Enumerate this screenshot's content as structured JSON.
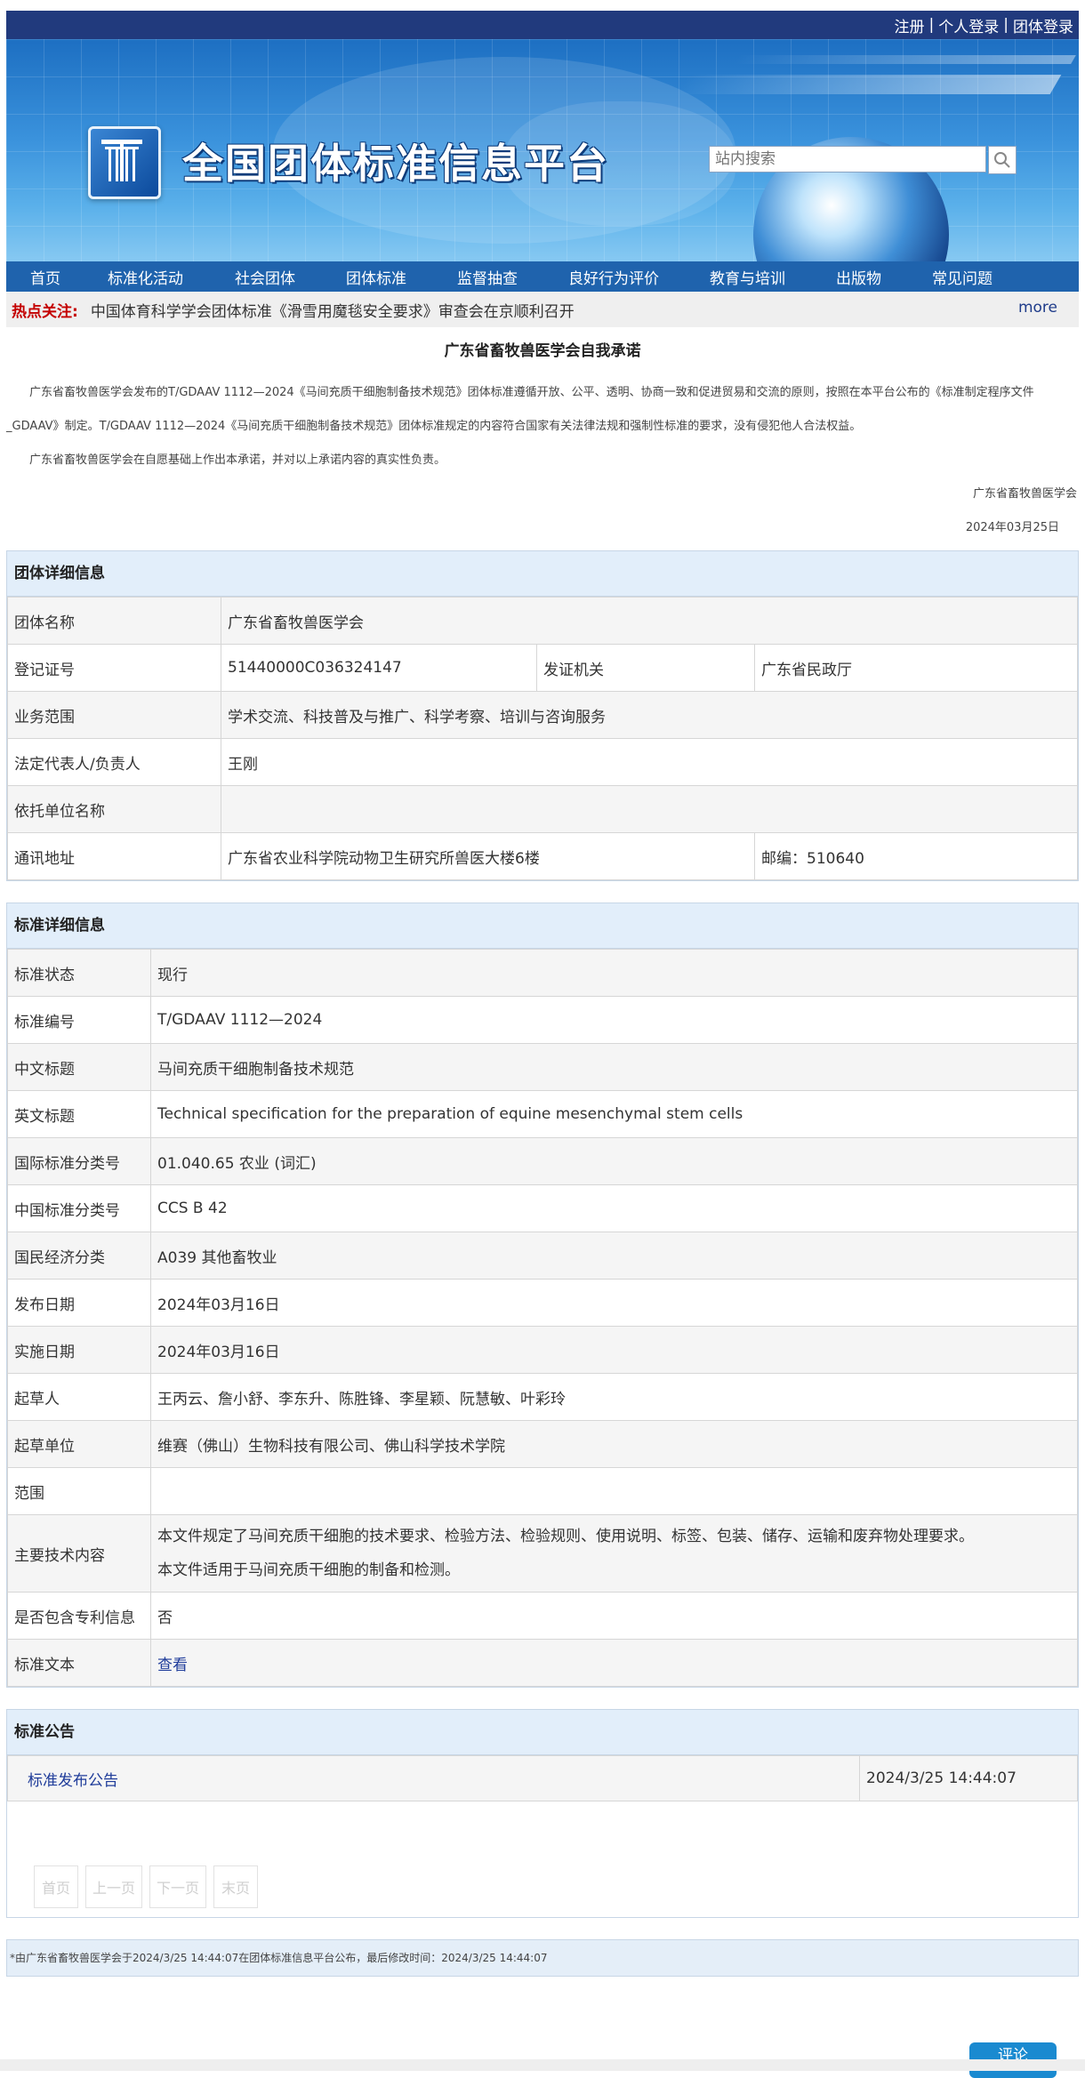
{
  "topbar": {
    "register": "注册",
    "personal_login": "个人登录",
    "group_login": "团体登录",
    "separator": "|"
  },
  "banner": {
    "site_title": "全国团体标准信息平台",
    "search_placeholder": "站内搜索"
  },
  "nav": {
    "items": [
      "首页",
      "标准化活动",
      "社会团体",
      "团体标准",
      "监督抽查",
      "良好行为评价",
      "教育与培训",
      "出版物",
      "常见问题"
    ]
  },
  "hot": {
    "label": "热点关注:",
    "news": "中国体育科学学会团体标准《滑雪用魔毯安全要求》审查会在京顺利召开",
    "more": "more"
  },
  "promise": {
    "title": "广东省畜牧兽医学会自我承诺",
    "p1": "广东省畜牧兽医学会发布的T/GDAAV 1112—2024《马间充质干细胞制备技术规范》团体标准遵循开放、公平、透明、协商一致和促进贸易和交流的原则，按照在本平台公布的《标准制定程序文件_GDAAV》制定。T/GDAAV 1112—2024《马间充质干细胞制备技术规范》团体标准规定的内容符合国家有关法律法规和强制性标准的要求，没有侵犯他人合法权益。",
    "p2": "广东省畜牧兽医学会在自愿基础上作出本承诺，并对以上承诺内容的真实性负责。",
    "sign": "广东省畜牧兽医学会",
    "date": "2024年03月25日"
  },
  "group": {
    "header": "团体详细信息",
    "name_label": "团体名称",
    "name": "广东省畜牧兽医学会",
    "reg_label": "登记证号",
    "reg": "51440000C036324147",
    "issuer_label": "发证机关",
    "issuer": "广东省民政厅",
    "scope_label": "业务范围",
    "scope": "学术交流、科技普及与推广、科学考察、培训与咨询服务",
    "rep_label": "法定代表人/负责人",
    "rep": "王刚",
    "unit_label": "依托单位名称",
    "unit": "",
    "addr_label": "通讯地址",
    "addr": "广东省农业科学院动物卫生研究所兽医大楼6楼",
    "zip": "邮编：510640"
  },
  "standard": {
    "header": "标准详细信息",
    "rows": [
      {
        "k": "标准状态",
        "v": "现行"
      },
      {
        "k": "标准编号",
        "v": "T/GDAAV 1112—2024"
      },
      {
        "k": "中文标题",
        "v": "马间充质干细胞制备技术规范"
      },
      {
        "k": "英文标题",
        "v": "Technical specification for the preparation of equine mesenchymal stem cells"
      },
      {
        "k": "国际标准分类号",
        "v": "01.040.65 农业 (词汇)"
      },
      {
        "k": "中国标准分类号",
        "v": "CCS B 42"
      },
      {
        "k": "国民经济分类",
        "v": "A039 其他畜牧业"
      },
      {
        "k": "发布日期",
        "v": "2024年03月16日"
      },
      {
        "k": "实施日期",
        "v": "2024年03月16日"
      },
      {
        "k": "起草人",
        "v": "王丙云、詹小舒、李东升、陈胜锋、李星颖、阮慧敏、叶彩玲"
      },
      {
        "k": "起草单位",
        "v": "维赛（佛山）生物科技有限公司、佛山科学技术学院"
      },
      {
        "k": "范围",
        "v": ""
      }
    ],
    "tech_label": "主要技术内容",
    "tech1": "本文件规定了马间充质干细胞的技术要求、检验方法、检验规则、使用说明、标签、包装、储存、运输和废弃物处理要求。",
    "tech2": "本文件适用于马间充质干细胞的制备和检测。",
    "patent_label": "是否包含专利信息",
    "patent": "否",
    "text_label": "标准文本",
    "text_link": "查看"
  },
  "notice": {
    "header": "标准公告",
    "item": "标准发布公告",
    "time": "2024/3/25 14:44:07",
    "pager": [
      "首页",
      "上一页",
      "下一页",
      "末页"
    ]
  },
  "footer": {
    "note": "*由广东省畜牧兽医学会于2024/3/25 14:44:07在团体标准信息平台公布，最后修改时间：2024/3/25 14:44:07",
    "comment": "评论"
  }
}
